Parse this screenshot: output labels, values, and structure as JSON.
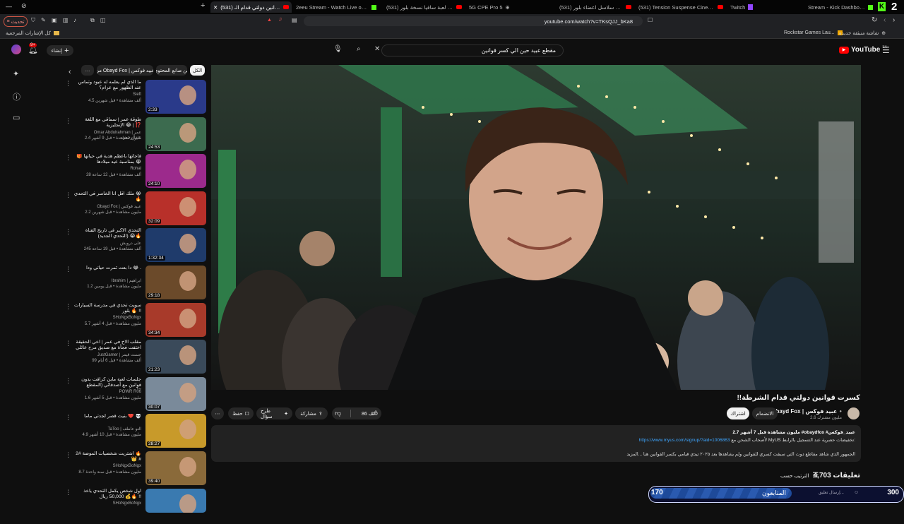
{
  "tabs": [
    {
      "label": "(531) كسرت قوانين دولتي قدام الـ...",
      "icon": "youtube-icon",
      "active": true
    },
    {
      "label": "2eeu Stream - Watch Live on Kick",
      "icon": "kick-icon",
      "active": false
    },
    {
      "label": "(531) سويت لعبة ساقيا نسخة بلور 🤔😡",
      "icon": "youtube-icon",
      "active": false
    },
    {
      "label": "5G CPE Pro 5",
      "icon": "globe-icon",
      "active": false
    },
    {
      "label": "(531) قلدت اشهر سلاسل اعضاء بلور !",
      "icon": "youtube-icon",
      "active": false
    },
    {
      "label": "(531) Tension Suspense Cinematic Fi",
      "icon": "youtube-icon",
      "active": false
    },
    {
      "label": "Twitch",
      "icon": "twitch-icon",
      "active": false
    },
    {
      "label": "Stream - Kick Dashboard",
      "icon": "kick-icon",
      "active": false
    }
  ],
  "browser": {
    "update_label": "تحديث",
    "url": "youtube.com/watch?v=TKsQJJ_bKa8",
    "corner_badge": "2"
  },
  "bookmarks": [
    {
      "label": "كل الإشارات المرجعية"
    },
    {
      "label": "Rockstar Games Lau..."
    },
    {
      "label": "شاشة منبثقة جديدة"
    }
  ],
  "header": {
    "logo": "YouTube",
    "logo_region": "SA",
    "search_value": "مقطع عبيد حين الي كسر قوانين",
    "create_label": "إنشاء",
    "notif_count": "9+"
  },
  "chips": [
    {
      "label": "الكل",
      "on": true
    },
    {
      "label": "من صانع المحتوى",
      "on": false
    },
    {
      "label": "من Obayd Fox | عبيد فوكس",
      "on": false
    },
    {
      "label": "…",
      "on": false
    }
  ],
  "recs": [
    {
      "title": "ما الذي لم يعلمه له عبود وتماس عند الظهور مع عزام؟",
      "channel": "Sleft",
      "meta": "4.5 ألف مشاهدة • قبل شهرين",
      "duration": "2:33",
      "thumb": "#2a3a8a"
    },
    {
      "title": "طوقة عمر | سماقي مع اللغة الإنجليزية 😂 | ⁉️",
      "channel": "Omar Abdulrahman | عمر عبدالرحمن",
      "meta": "2.4 مليون مشاهدة • قبل 9 أشهر",
      "duration": "24:53",
      "thumb": "#3c6b4f"
    },
    {
      "title": "فاجأتها بأعظم هدية في حياتها 🎁 بمناسبة عيد ميلادها 😭",
      "channel": "Rohal",
      "meta": "28 ألف مشاهدة • قبل 12 ساعة",
      "duration": "24:10",
      "thumb": "#9c2a8c"
    },
    {
      "title": "ملك أقل أنا الخاسر في التحدي 😭🔥",
      "channel": "Obayd Fox | عبيد فوكس",
      "meta": "2.2 مليون مشاهدة • قبل شهرين",
      "duration": "32:09",
      "thumb": "#b8302a"
    },
    {
      "title": "التحدي الأكبر في تاريخ القناة (التحدي الجديد) 😭🔥",
      "channel": "على درويش",
      "meta": "245 ألف مشاهدة • قبل 19 ساعة",
      "duration": "1:32:34",
      "thumb": "#1f3b6b"
    },
    {
      "title": "دا بعت ثمرت حياتي ودا 😂 .",
      "channel": "Ibrahim | ابراهيم",
      "meta": "1.2 مليون مشاهدة • قبل يومين",
      "duration": "29:18",
      "thumb": "#6b4a2a"
    },
    {
      "title": "سويت تحدي في مدرسة السيارات بلور 🔥 !!",
      "channel": "SHoNgxBoNgx",
      "meta": "5.7 مليون مشاهدة • قبل 4 أشهر",
      "duration": "34:34",
      "thumb": "#a83a2a"
    },
    {
      "title": "مقلب الأخ في عمر | أخي الحقيقة اختفت فجأة مع صديق مرح عائلي",
      "channel": "JustGamer | جست قيمر",
      "meta": "99 ألف مشاهدة • قبل 6 أيام",
      "duration": "21:23",
      "thumb": "#3a4a5a"
    },
    {
      "title": "جلسات لعبة ماين كرافت بدون قوانين مع أصدقائي (المقطع الأخير)",
      "channel": "POWR R06",
      "meta": "1.6 مليون مشاهدة • قبل 5 أشهر",
      "duration": "30:07",
      "thumb": "#7a8a9a"
    },
    {
      "title": "بنيت قصر لجدتي ماما ❤️ 💀",
      "channel": "TaToo | التو عاطف",
      "meta": "4.9 مليون مشاهدة • قبل 10 أشهر",
      "duration": "28:27",
      "thumb": "#c89a2a"
    },
    {
      "title": "أشتريت شخصيات الموضة #2 🔥 👑 #",
      "channel": "SHoNgxBoNgx",
      "meta": "8.7 مليون مشاهدة • قبل سنة واحدة",
      "duration": "39:40",
      "thumb": "#8a6a3a"
    },
    {
      "title": "أول شخص يكمل التحدي ياخذ 50,000 ريال 💰🔥 !!",
      "channel": "SHoNgxBoNgx",
      "meta": "",
      "duration": "",
      "thumb": "#3a7ab0"
    }
  ],
  "video": {
    "title": "كسرت قوانين دولتي قدام الشرطة!!",
    "channel": "Obayd Fox | عبيد فوكس",
    "subs": "2.6 مليون مشترك",
    "join_label": "الانضمام",
    "subscribe_label": "اشتراك",
    "likes": "86 ألف",
    "share_label": "مشاركة",
    "ask_label": "طرح سؤال",
    "save_label": "حفظ"
  },
  "description": {
    "stats": "2.7 مليون مشاهدة  قبل 7 أشهر  #obaydfox #عبيد_فوكس",
    "link": "https://www.myus.com/signup/?aid=1006863",
    "link_line_rest": " لأصحاب الشحن مع MyUS تخفيضات حصرية عند التسجيل بالرابط:",
    "body": "الجمهور الذي شاهد مقاطع دوت التي سبقت كسري للقوانين ولم يشاهدها بعد ٢٠٢٥ تيدي قيامي بكسر القوانين هنا ...المزيد"
  },
  "comments": {
    "count": "4,703 تعليقات",
    "sort_label": "الترتيب حسب"
  },
  "overlay": {
    "left_value": "170",
    "label": "المتابعون",
    "right_value": "300",
    "input_placeholder": "إرسال تعليق..."
  }
}
